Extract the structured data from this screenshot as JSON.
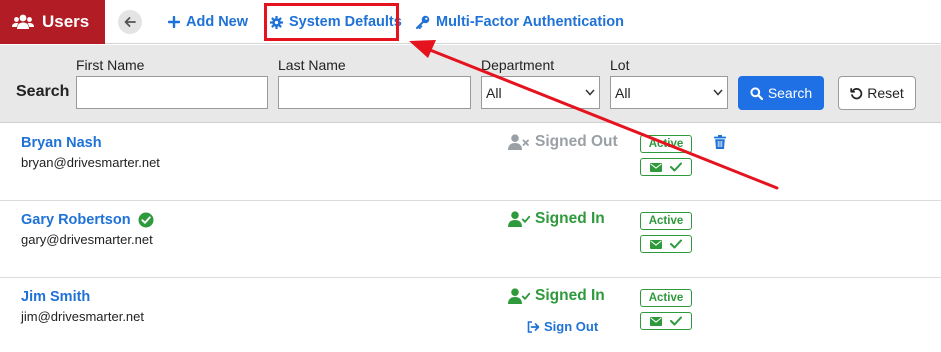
{
  "header": {
    "title": "Users",
    "nav": {
      "add_new": "Add New",
      "system_defaults": "System Defaults",
      "mfa": "Multi-Factor Authentication"
    }
  },
  "search": {
    "title": "Search",
    "first_name_label": "First Name",
    "first_name_value": "",
    "last_name_label": "Last Name",
    "last_name_value": "",
    "department_label": "Department",
    "department_selected": "All",
    "lot_label": "Lot",
    "lot_selected": "All",
    "search_button": "Search",
    "reset_button": "Reset"
  },
  "users": [
    {
      "name": "Bryan Nash",
      "email": "bryan@drivesmarter.net",
      "status": "Signed Out",
      "badge": "Active"
    },
    {
      "name": "Gary Robertson",
      "email": "gary@drivesmarter.net",
      "status": "Signed In",
      "badge": "Active"
    },
    {
      "name": "Jim Smith",
      "email": "jim@drivesmarter.net",
      "status": "Signed In",
      "badge": "Active",
      "sign_out_label": "Sign Out"
    }
  ],
  "colors": {
    "brand": "#b21c24",
    "link": "#1f72d6",
    "success": "#2e9a3c",
    "annotation": "#e5131d",
    "search_button": "#1f6fe5"
  }
}
